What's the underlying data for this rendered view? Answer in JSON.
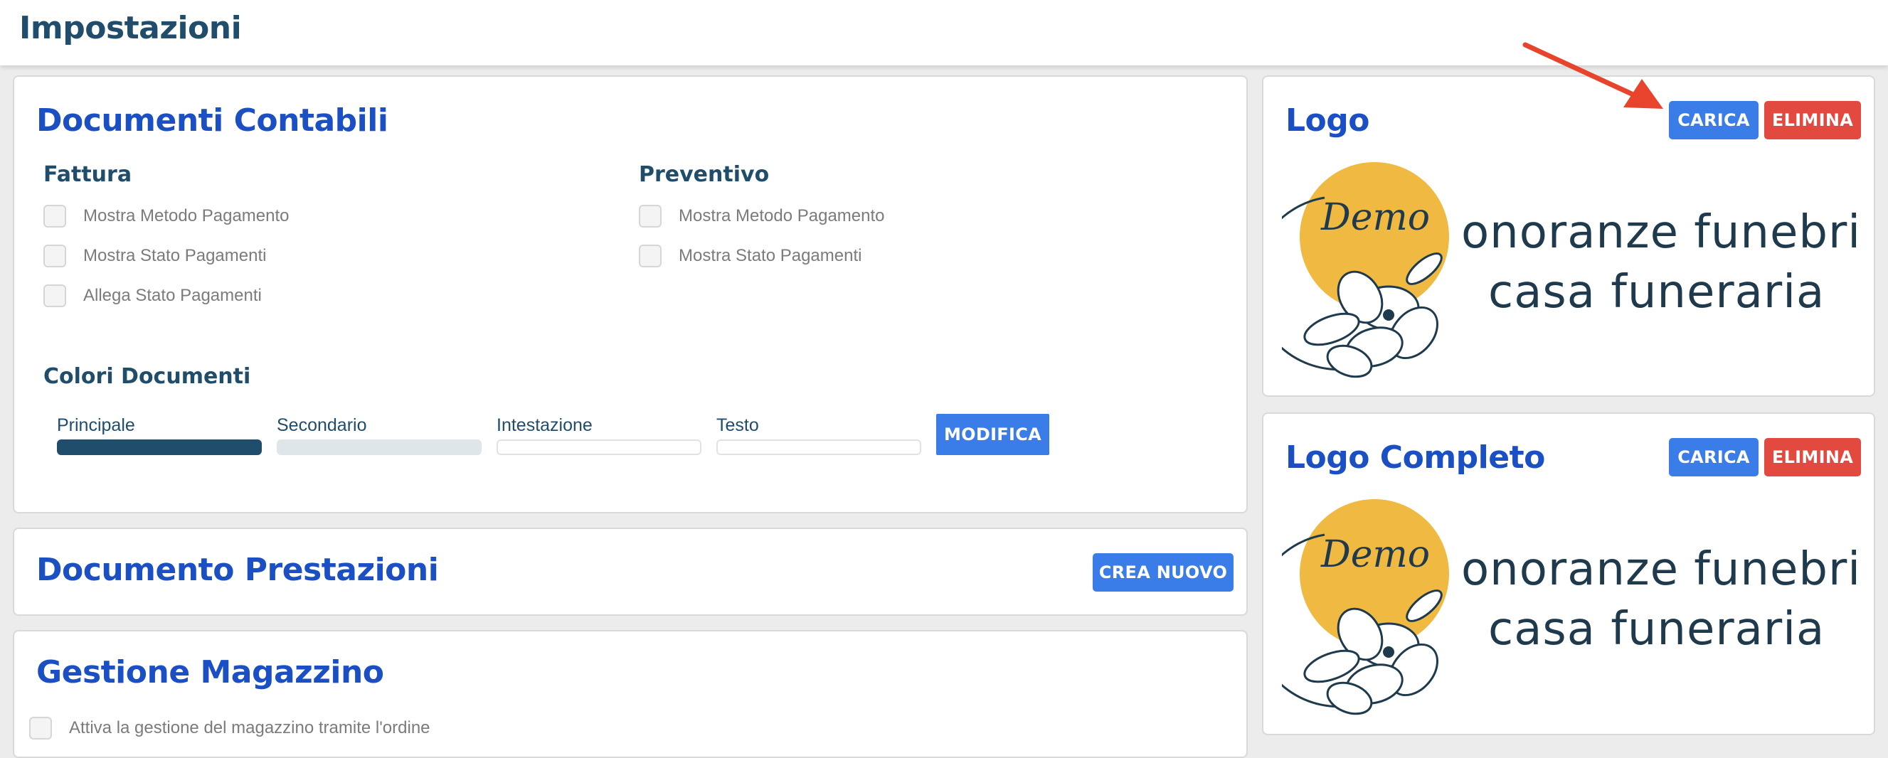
{
  "header": {
    "title": "Impostazioni"
  },
  "documenti_contabili": {
    "title": "Documenti Contabili",
    "fattura": {
      "heading": "Fattura",
      "options": [
        "Mostra Metodo Pagamento",
        "Mostra Stato Pagamenti",
        "Allega Stato Pagamenti"
      ]
    },
    "preventivo": {
      "heading": "Preventivo",
      "options": [
        "Mostra Metodo Pagamento",
        "Mostra Stato Pagamenti"
      ]
    },
    "colori": {
      "heading": "Colori Documenti",
      "items": [
        {
          "label": "Principale",
          "color": "#1f4d6b"
        },
        {
          "label": "Secondario",
          "color": "#dfe6ea"
        },
        {
          "label": "Intestazione",
          "color": "#ffffff"
        },
        {
          "label": "Testo",
          "color": "#ffffff"
        }
      ],
      "button": "MODIFICA"
    }
  },
  "documento_prestazioni": {
    "title": "Documento Prestazioni",
    "button": "CREA NUOVO"
  },
  "gestione_magazzino": {
    "title": "Gestione Magazzino",
    "option": "Attiva la gestione del magazzino tramite l'ordine"
  },
  "logo": {
    "title": "Logo",
    "upload_button": "CARICA",
    "delete_button": "ELIMINA",
    "image": {
      "script_text": "Demo",
      "line1": "onoranze funebri",
      "line2": "casa funeraria"
    }
  },
  "logo_completo": {
    "title": "Logo Completo",
    "upload_button": "CARICA",
    "delete_button": "ELIMINA",
    "image": {
      "script_text": "Demo",
      "line1": "onoranze funebri",
      "line2": "casa funeraria"
    }
  },
  "colors": {
    "accent": "#3b7de8",
    "danger": "#e34a3f",
    "title": "#1b4fc4",
    "logo_circle": "#f0b942",
    "annotation_arrow": "#e8432c"
  }
}
